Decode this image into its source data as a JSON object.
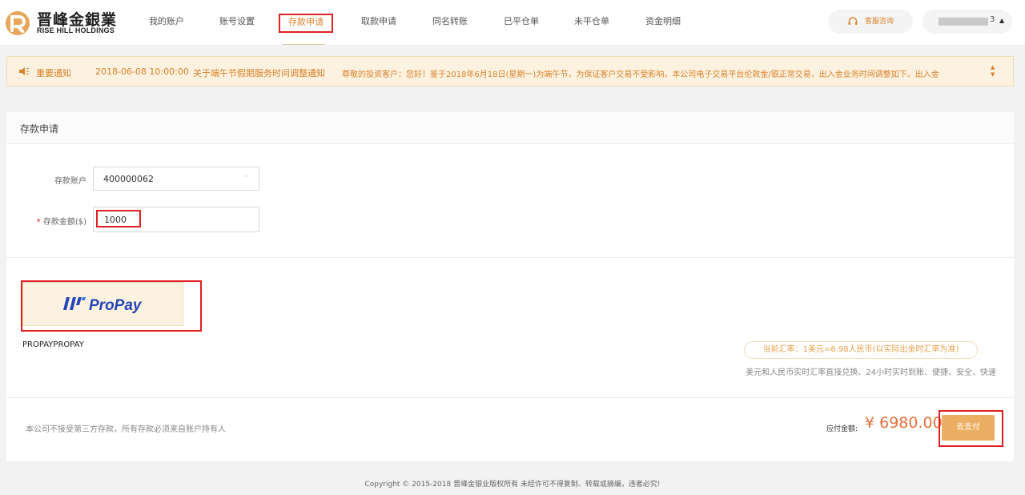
{
  "header": {
    "logo_cn": "晋峰金銀業",
    "logo_en": "RISE HILL HOLDINGS",
    "nav": [
      {
        "label": "我的账户"
      },
      {
        "label": "账号设置"
      },
      {
        "label": "存款申请"
      },
      {
        "label": "取款申请"
      },
      {
        "label": "同名转账"
      },
      {
        "label": "已平仓单"
      },
      {
        "label": "未平仓单"
      },
      {
        "label": "资金明细"
      }
    ],
    "active_nav": "存款申请",
    "service_label": "客服咨询",
    "user_suffix": "3",
    "user_caret": "▲"
  },
  "notice": {
    "label": "重要通知",
    "datetime": "2018-06-08 10:00:00",
    "title": "关于端午节假期服务时间调整通知",
    "body": "尊敬的投资客户：您好！鉴于2018年6月18日(星期一)为端午节，为保证客户交易不受影响，本公司电子交易平台伦敦金/银正常交易，出入金业务时间调整如下。出入金",
    "scroll_up": "▲",
    "scroll_down": "▼"
  },
  "card": {
    "title": "存款申请",
    "account_label": "存款账户",
    "account_value": "400000062",
    "account_caret": "⌃",
    "amount_required_mark": "*",
    "amount_label": "存款金额($)",
    "amount_value": "1000",
    "payment_brand": "ProPay",
    "payment_name": "PROPAYPROPAY",
    "rate_text": "当前汇率：1美元=6.98人民币(以实际出金时汇率为准)",
    "rate_desc": "美元和人民币实时汇率直接兑换、24小时实时到账、便捷、安全、快速",
    "disclaimer": "本公司不接受第三方存款，所有存款必须来自账户持有人",
    "amount_due_label": "应付金额:",
    "amount_due_value": "¥ 6980.00",
    "pay_button": "去支付"
  },
  "footer": {
    "copyright": "Copyright © 2015-2018 晋峰金银业版权所有 未经许可不得复制、转载或摘编，违者必究!"
  },
  "colors": {
    "accent": "#d9822b",
    "highlight_box": "#e02020",
    "pay_button": "#ecae62",
    "notice_bg": "#fdf2df",
    "amount": "#e8713c",
    "propay_blue": "#2346b8"
  }
}
